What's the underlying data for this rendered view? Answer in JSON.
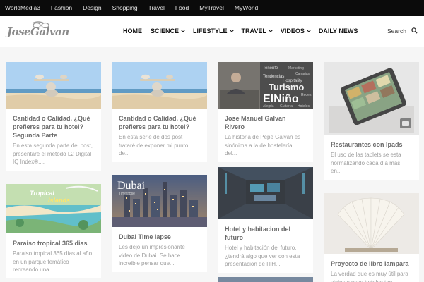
{
  "topbar": {
    "links": [
      "WorldMedia3",
      "Fashion",
      "Design",
      "Shopping",
      "Travel",
      "Food",
      "MyTravel",
      "MyWorld"
    ]
  },
  "header": {
    "logo_text": "JoseGalvan",
    "nav": [
      "HOME",
      "SCIENCE",
      "LIFESTYLE",
      "TRAVEL",
      "VIDEOS",
      "DAILY NEWS"
    ],
    "search_label": "Search"
  },
  "cards": [
    {
      "title": "Cantidad o Calidad. ¿Qué prefieres para tu hotel? Segunda Parte",
      "excerpt": "En esta segunda parte del post, presentaré el método L2 Digital IQ Index®,..."
    },
    {
      "title": "Cantidad o Calidad. ¿Qué prefieres para tu hotel?",
      "excerpt": "En esta serie de dos post trataré de exponer mi punto de..."
    },
    {
      "title": "Jose Manuel Galvan Rivero",
      "excerpt": "La historia de Pepe Galván es sinónima a la de hostelería del...",
      "image_words": [
        "Tenerife",
        "Marketing",
        "Canarias",
        "Tendencias",
        "Hospitality",
        "Turismo",
        "ElNiño",
        "Alegria",
        "Guitarra",
        "Redes",
        "Hoteles"
      ]
    },
    {
      "title": "Restaurantes con Ipads",
      "excerpt": "El uso de las tablets se esta normalizando cada día más en..."
    },
    {
      "title": "Paraiso tropical 365 dias",
      "excerpt": "Paraiso tropical 365 días al año en un parque temático recreando una...",
      "image_words": [
        "Tropical",
        "Islands"
      ]
    },
    {
      "title": "Dubai Time lapse",
      "excerpt": "Les dejo un impresionante video de Dubai. Se hace increible pensar que...",
      "image_words": [
        "Dubai",
        "Timelapse"
      ]
    },
    {
      "title": "Hotel y habitacion del futuro",
      "excerpt": "Hotel y habitación del futuro, ¿tendrá algo que ver con esta presentación de ITH..."
    },
    {
      "title": "Proyecto de libro lampara",
      "excerpt": "La verdad que es muy útil para viajes y esos hoteles tan..."
    }
  ]
}
